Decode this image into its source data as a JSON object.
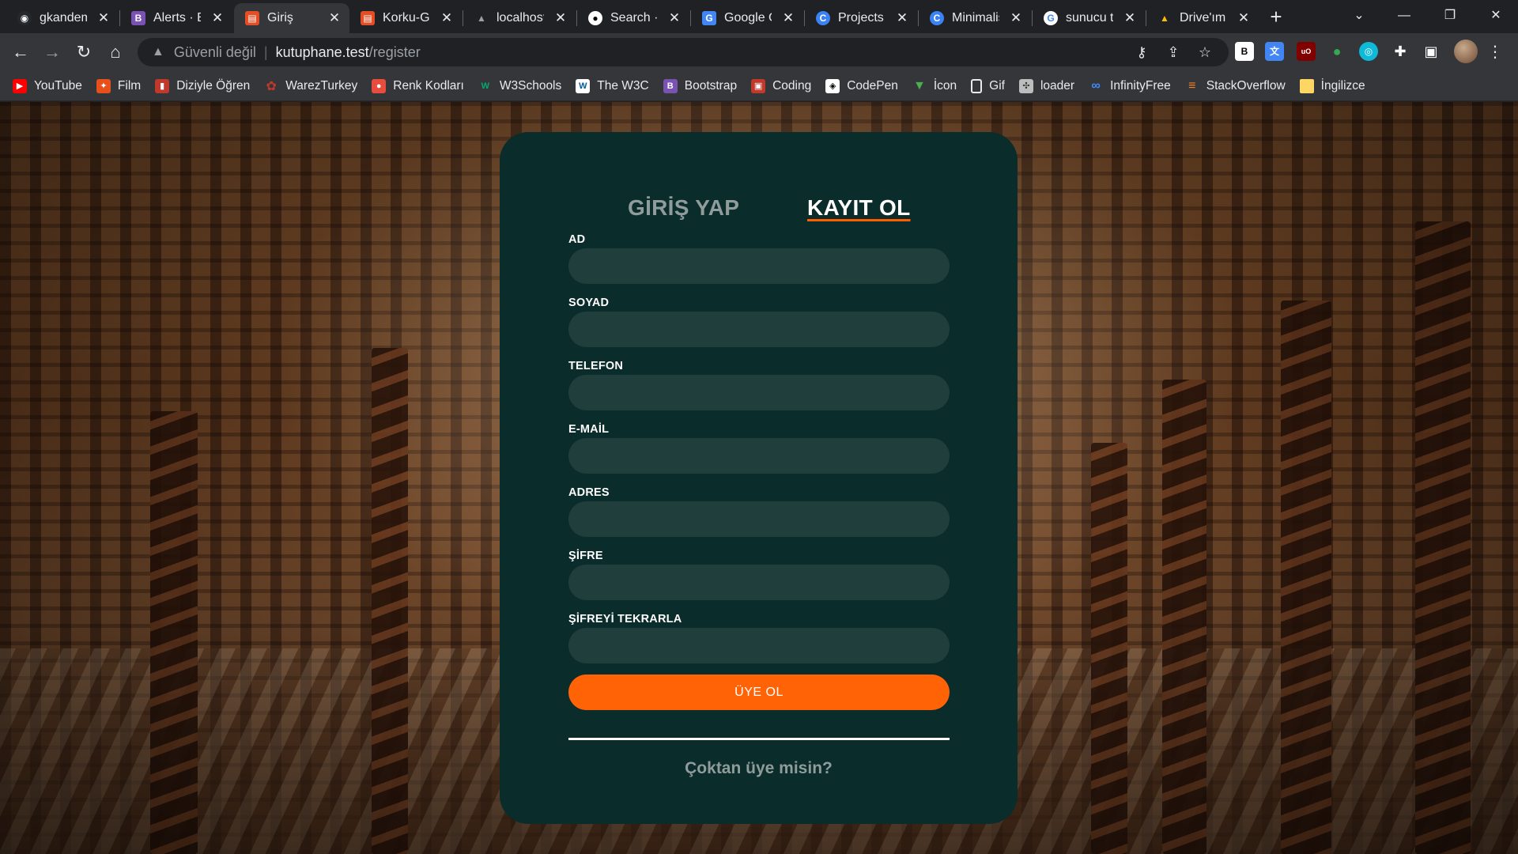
{
  "browser": {
    "tabs": [
      {
        "title": "gkandem",
        "favicon": "github-avatar-icon",
        "color": "#24292f"
      },
      {
        "title": "Alerts · Bo",
        "favicon": "bootstrap-icon",
        "color": "#7952b3"
      },
      {
        "title": "Giriş",
        "favicon": "page-icon",
        "color": "#e44d26"
      },
      {
        "title": "Korku-Ge",
        "favicon": "page-icon",
        "color": "#e44d26"
      },
      {
        "title": "localhost",
        "favicon": "laragon-icon",
        "color": "#9aa0a6"
      },
      {
        "title": "Search · f",
        "favicon": "github-icon",
        "color": "#ffffff"
      },
      {
        "title": "Google Ç",
        "favicon": "google-translate-icon",
        "color": "#4285f4"
      },
      {
        "title": "Projects ·",
        "favicon": "c-icon",
        "color": "#3b82f6"
      },
      {
        "title": "Minimalis",
        "favicon": "c-icon",
        "color": "#3b82f6"
      },
      {
        "title": "sunucu ta",
        "favicon": "google-icon",
        "color": "#ffffff"
      },
      {
        "title": "Drive'ım ·",
        "favicon": "google-drive-icon",
        "color": "#fbbc04"
      }
    ],
    "active_tab_index": 2,
    "address": {
      "security_text": "Güvenli değil",
      "host": "kutuphane.test",
      "path": "/register"
    },
    "extensions": [
      {
        "name": "b-extension-icon",
        "label": "B",
        "color": "#ffffff"
      },
      {
        "name": "translate-extension-icon",
        "label": "文",
        "color": "#4285f4"
      },
      {
        "name": "ublock-icon",
        "label": "uO",
        "color": "#800000"
      },
      {
        "name": "color-extension-icon",
        "label": "●",
        "color": "#34a853"
      },
      {
        "name": "wappalyzer-icon",
        "label": "◎",
        "color": "#0fb9d8"
      }
    ],
    "bookmarks": [
      {
        "label": "YouTube",
        "icon": "youtube-icon",
        "color": "#ff0000"
      },
      {
        "label": "Film",
        "icon": "film-icon",
        "color": "#e8501b"
      },
      {
        "label": "Diziyle Öğren",
        "icon": "diziyle-icon",
        "color": "#c0392b"
      },
      {
        "label": "WarezTurkey",
        "icon": "warez-icon",
        "color": "#c0392b"
      },
      {
        "label": "Renk Kodları",
        "icon": "renk-icon",
        "color": "#e74c3c"
      },
      {
        "label": "W3Schools",
        "icon": "w3schools-icon",
        "color": "#04aa6d"
      },
      {
        "label": "The W3C",
        "icon": "w3c-icon",
        "color": "#ffffff"
      },
      {
        "label": "Bootstrap",
        "icon": "bootstrap-icon",
        "color": "#7952b3"
      },
      {
        "label": "Coding",
        "icon": "coding-icon",
        "color": "#c0392b"
      },
      {
        "label": "CodePen",
        "icon": "codepen-icon",
        "color": "#ffffff"
      },
      {
        "label": "İcon",
        "icon": "icon-site-icon",
        "color": "#4caf50"
      },
      {
        "label": "Gif",
        "icon": "document-icon",
        "color": "#ffffff"
      },
      {
        "label": "loader",
        "icon": "loader-icon",
        "color": "#bdbdbd"
      },
      {
        "label": "InfinityFree",
        "icon": "infinity-icon",
        "color": "#3f8cff"
      },
      {
        "label": "StackOverflow",
        "icon": "stackoverflow-icon",
        "color": "#f48024"
      },
      {
        "label": "İngilizce",
        "icon": "folder-icon",
        "color": "#fdd663"
      }
    ]
  },
  "page": {
    "tabs": {
      "login": "GİRİŞ YAP",
      "register": "KAYIT OL"
    },
    "fields": [
      {
        "id": "ad",
        "label": "AD",
        "value": ""
      },
      {
        "id": "soyad",
        "label": "SOYAD",
        "value": ""
      },
      {
        "id": "telefon",
        "label": "TELEFON",
        "value": ""
      },
      {
        "id": "email",
        "label": "E-MAİL",
        "value": ""
      },
      {
        "id": "adres",
        "label": "ADRES",
        "value": ""
      },
      {
        "id": "sifre",
        "label": "ŞİFRE",
        "value": ""
      },
      {
        "id": "sifre-tekrar",
        "label": "ŞİFREYİ TEKRARLA",
        "value": ""
      }
    ],
    "submit_label": "ÜYE OL",
    "already_member": "Çoktan üye misin?",
    "colors": {
      "card": "#0a2c2a",
      "input": "#1f3e3c",
      "accent": "#ff6306",
      "muted": "#8f9c9b"
    }
  }
}
